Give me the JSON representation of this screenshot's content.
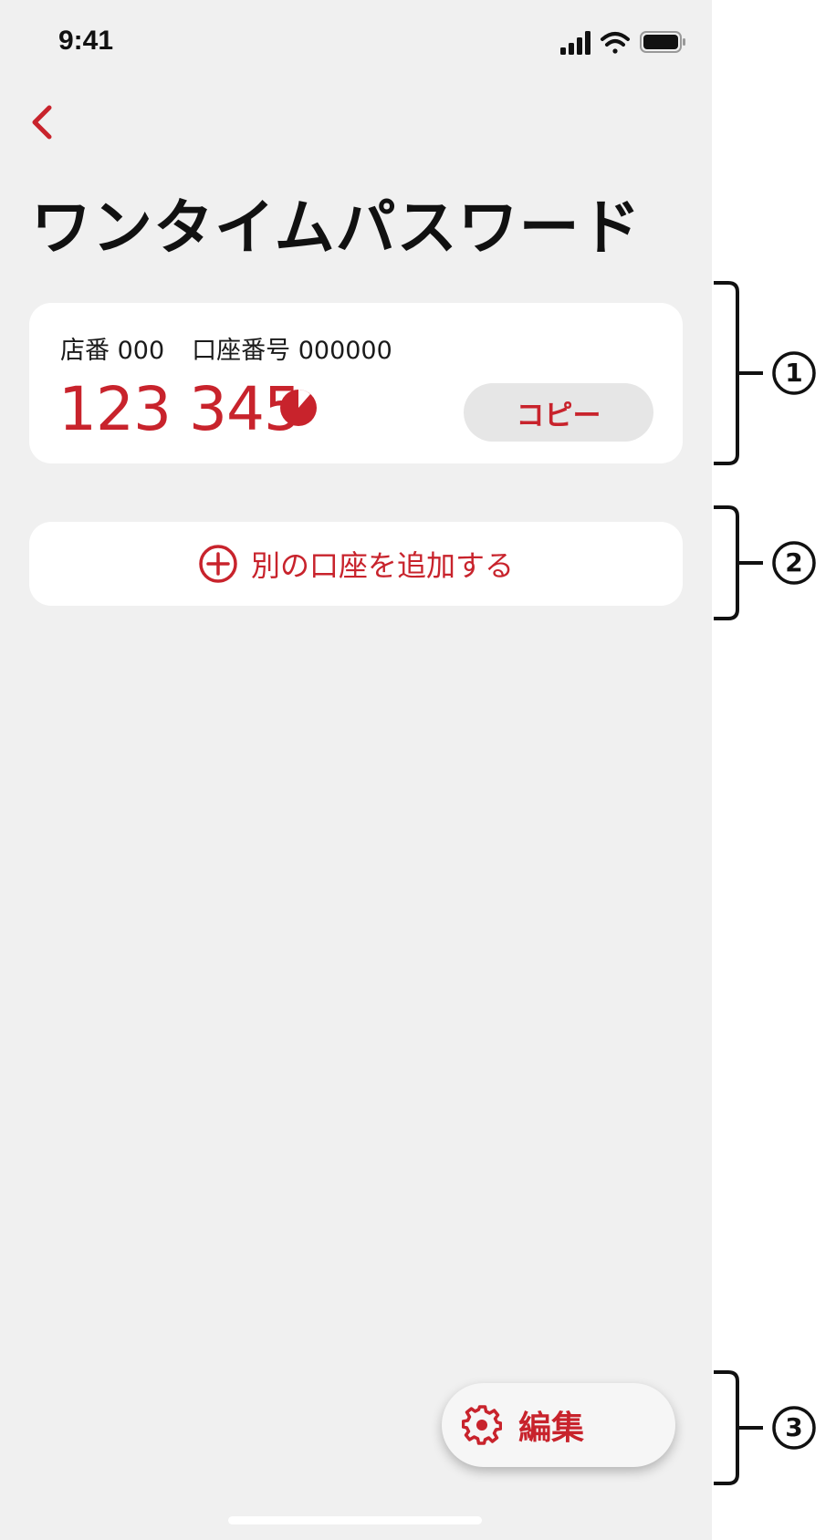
{
  "status_bar": {
    "time": "9:41"
  },
  "header": {
    "title": "ワンタイムパスワード"
  },
  "otp_card": {
    "branch_label": "店番 000",
    "account_label": "口座番号 000000",
    "code": "123 345",
    "copy_label": "コピー"
  },
  "add_account": {
    "label": "別の口座を追加する"
  },
  "edit": {
    "label": "編集"
  },
  "annotations": [
    "1",
    "2",
    "3"
  ],
  "colors": {
    "accent": "#c8232c",
    "background": "#f0f0f0",
    "card": "#ffffff"
  }
}
